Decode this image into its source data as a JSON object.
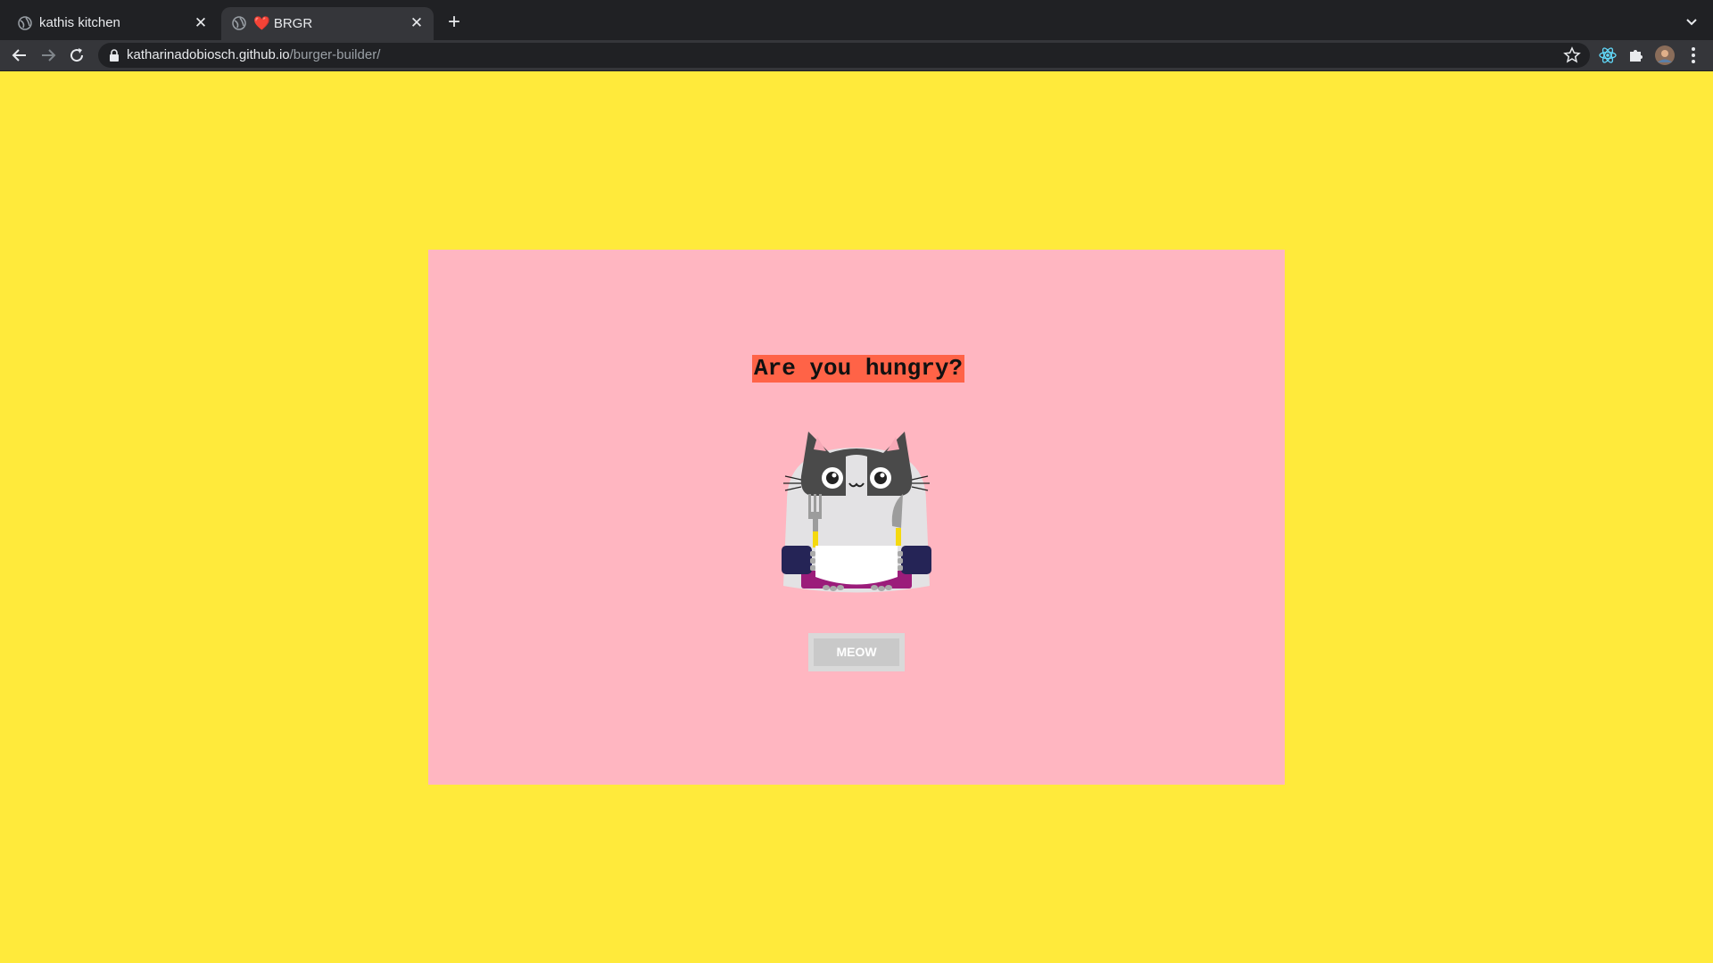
{
  "browser": {
    "tabs": [
      {
        "title": "kathis kitchen",
        "active": false
      },
      {
        "title": "❤️ BRGR",
        "active": true
      }
    ],
    "url_host": "katharinadobiosch.github.io",
    "url_path": "/burger-builder/",
    "icons": [
      "back-icon",
      "forward-icon",
      "reload-icon",
      "lock-icon",
      "star-icon",
      "react-devtools-icon",
      "puzzle-icon",
      "profile-avatar",
      "kebab-menu-icon",
      "tab-search-icon",
      "new-tab-icon",
      "close-icon"
    ]
  },
  "page": {
    "headline": "Are you hungry?",
    "button_label": "MEOW",
    "colors": {
      "background": "#ffea3b",
      "card": "#ffb6c1",
      "headline_highlight": "#ff6347",
      "button": "#c9c9c9"
    }
  }
}
